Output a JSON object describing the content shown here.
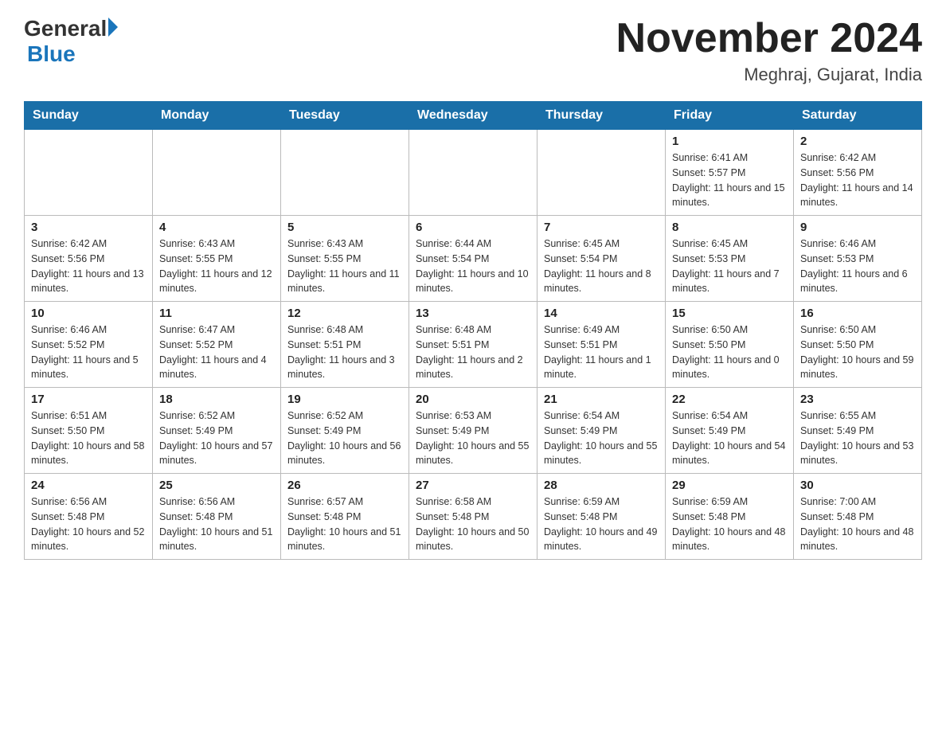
{
  "logo": {
    "general": "General",
    "blue": "Blue"
  },
  "title": {
    "month_year": "November 2024",
    "location": "Meghraj, Gujarat, India"
  },
  "weekdays": [
    "Sunday",
    "Monday",
    "Tuesday",
    "Wednesday",
    "Thursday",
    "Friday",
    "Saturday"
  ],
  "weeks": [
    [
      {
        "day": "",
        "info": ""
      },
      {
        "day": "",
        "info": ""
      },
      {
        "day": "",
        "info": ""
      },
      {
        "day": "",
        "info": ""
      },
      {
        "day": "",
        "info": ""
      },
      {
        "day": "1",
        "info": "Sunrise: 6:41 AM\nSunset: 5:57 PM\nDaylight: 11 hours and 15 minutes."
      },
      {
        "day": "2",
        "info": "Sunrise: 6:42 AM\nSunset: 5:56 PM\nDaylight: 11 hours and 14 minutes."
      }
    ],
    [
      {
        "day": "3",
        "info": "Sunrise: 6:42 AM\nSunset: 5:56 PM\nDaylight: 11 hours and 13 minutes."
      },
      {
        "day": "4",
        "info": "Sunrise: 6:43 AM\nSunset: 5:55 PM\nDaylight: 11 hours and 12 minutes."
      },
      {
        "day": "5",
        "info": "Sunrise: 6:43 AM\nSunset: 5:55 PM\nDaylight: 11 hours and 11 minutes."
      },
      {
        "day": "6",
        "info": "Sunrise: 6:44 AM\nSunset: 5:54 PM\nDaylight: 11 hours and 10 minutes."
      },
      {
        "day": "7",
        "info": "Sunrise: 6:45 AM\nSunset: 5:54 PM\nDaylight: 11 hours and 8 minutes."
      },
      {
        "day": "8",
        "info": "Sunrise: 6:45 AM\nSunset: 5:53 PM\nDaylight: 11 hours and 7 minutes."
      },
      {
        "day": "9",
        "info": "Sunrise: 6:46 AM\nSunset: 5:53 PM\nDaylight: 11 hours and 6 minutes."
      }
    ],
    [
      {
        "day": "10",
        "info": "Sunrise: 6:46 AM\nSunset: 5:52 PM\nDaylight: 11 hours and 5 minutes."
      },
      {
        "day": "11",
        "info": "Sunrise: 6:47 AM\nSunset: 5:52 PM\nDaylight: 11 hours and 4 minutes."
      },
      {
        "day": "12",
        "info": "Sunrise: 6:48 AM\nSunset: 5:51 PM\nDaylight: 11 hours and 3 minutes."
      },
      {
        "day": "13",
        "info": "Sunrise: 6:48 AM\nSunset: 5:51 PM\nDaylight: 11 hours and 2 minutes."
      },
      {
        "day": "14",
        "info": "Sunrise: 6:49 AM\nSunset: 5:51 PM\nDaylight: 11 hours and 1 minute."
      },
      {
        "day": "15",
        "info": "Sunrise: 6:50 AM\nSunset: 5:50 PM\nDaylight: 11 hours and 0 minutes."
      },
      {
        "day": "16",
        "info": "Sunrise: 6:50 AM\nSunset: 5:50 PM\nDaylight: 10 hours and 59 minutes."
      }
    ],
    [
      {
        "day": "17",
        "info": "Sunrise: 6:51 AM\nSunset: 5:50 PM\nDaylight: 10 hours and 58 minutes."
      },
      {
        "day": "18",
        "info": "Sunrise: 6:52 AM\nSunset: 5:49 PM\nDaylight: 10 hours and 57 minutes."
      },
      {
        "day": "19",
        "info": "Sunrise: 6:52 AM\nSunset: 5:49 PM\nDaylight: 10 hours and 56 minutes."
      },
      {
        "day": "20",
        "info": "Sunrise: 6:53 AM\nSunset: 5:49 PM\nDaylight: 10 hours and 55 minutes."
      },
      {
        "day": "21",
        "info": "Sunrise: 6:54 AM\nSunset: 5:49 PM\nDaylight: 10 hours and 55 minutes."
      },
      {
        "day": "22",
        "info": "Sunrise: 6:54 AM\nSunset: 5:49 PM\nDaylight: 10 hours and 54 minutes."
      },
      {
        "day": "23",
        "info": "Sunrise: 6:55 AM\nSunset: 5:49 PM\nDaylight: 10 hours and 53 minutes."
      }
    ],
    [
      {
        "day": "24",
        "info": "Sunrise: 6:56 AM\nSunset: 5:48 PM\nDaylight: 10 hours and 52 minutes."
      },
      {
        "day": "25",
        "info": "Sunrise: 6:56 AM\nSunset: 5:48 PM\nDaylight: 10 hours and 51 minutes."
      },
      {
        "day": "26",
        "info": "Sunrise: 6:57 AM\nSunset: 5:48 PM\nDaylight: 10 hours and 51 minutes."
      },
      {
        "day": "27",
        "info": "Sunrise: 6:58 AM\nSunset: 5:48 PM\nDaylight: 10 hours and 50 minutes."
      },
      {
        "day": "28",
        "info": "Sunrise: 6:59 AM\nSunset: 5:48 PM\nDaylight: 10 hours and 49 minutes."
      },
      {
        "day": "29",
        "info": "Sunrise: 6:59 AM\nSunset: 5:48 PM\nDaylight: 10 hours and 48 minutes."
      },
      {
        "day": "30",
        "info": "Sunrise: 7:00 AM\nSunset: 5:48 PM\nDaylight: 10 hours and 48 minutes."
      }
    ]
  ]
}
